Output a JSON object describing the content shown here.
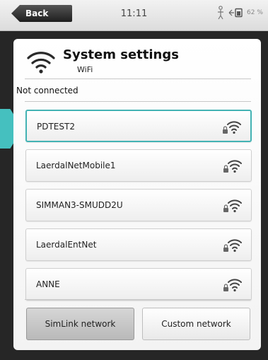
{
  "statusbar": {
    "back_label": "Back",
    "time": "11:11",
    "battery_text": "62 %",
    "icons": [
      "person-icon",
      "battery-icon"
    ]
  },
  "header": {
    "title": "System settings",
    "subtitle": "WiFi",
    "icon": "wifi-icon"
  },
  "connection_status": "Not connected",
  "networks": [
    {
      "name": "PDTEST2",
      "secured": true,
      "selected": true
    },
    {
      "name": "LaerdalNetMobile1",
      "secured": true,
      "selected": false
    },
    {
      "name": "SIMMAN3-SMUDD2U",
      "secured": true,
      "selected": false
    },
    {
      "name": "LaerdalEntNet",
      "secured": true,
      "selected": false
    },
    {
      "name": "ANNE",
      "secured": true,
      "selected": false
    }
  ],
  "buttons": {
    "simlink": "SimLink network",
    "custom": "Custom network"
  },
  "colors": {
    "accent": "#43b3b4",
    "panel": "#ffffff",
    "frame": "#262626"
  }
}
